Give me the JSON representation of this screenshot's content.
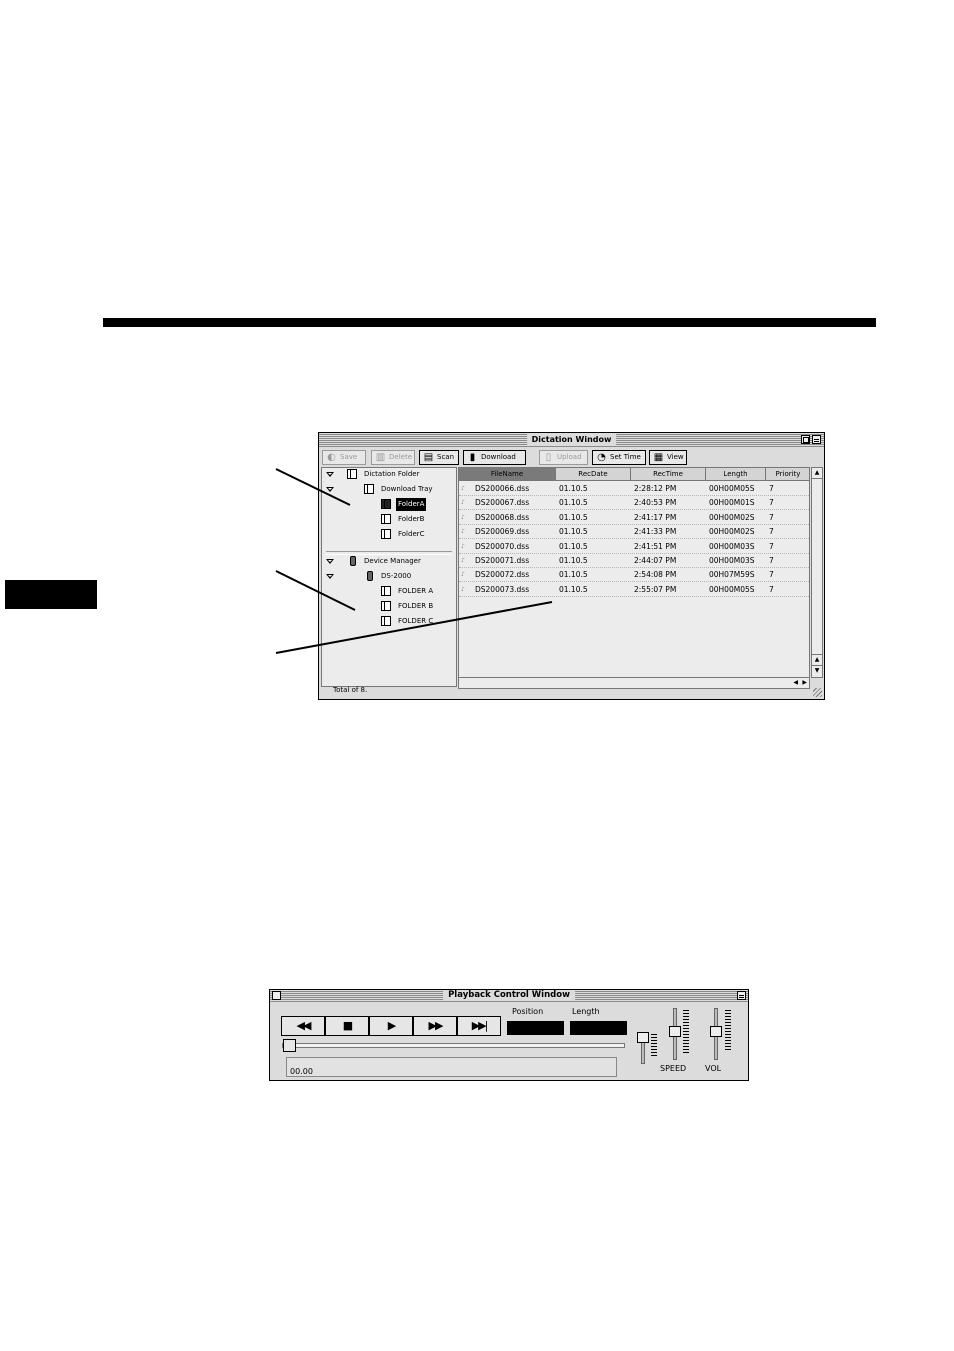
{
  "dictation_window": {
    "title": "Dictation Window",
    "toolbar": [
      {
        "label": "Save",
        "icon": "save-icon",
        "glyph": "◐",
        "enabled": false
      },
      {
        "label": "Delete",
        "icon": "trash-icon",
        "glyph": "▥",
        "enabled": false
      },
      {
        "label": "Scan",
        "icon": "scan-icon",
        "glyph": "▤",
        "enabled": true
      },
      {
        "label": "Download",
        "icon": "download-icon",
        "glyph": "▮",
        "enabled": true
      },
      {
        "label": "Upload",
        "icon": "upload-icon",
        "glyph": "▯",
        "enabled": false
      },
      {
        "label": "Set Time",
        "icon": "clock-icon",
        "glyph": "◔",
        "enabled": true
      },
      {
        "label": "View",
        "icon": "view-icon",
        "glyph": "▦",
        "enabled": true
      }
    ],
    "tree": {
      "dictation_folder": "Dictation Folder",
      "download_tray": "Download Tray",
      "folder_a": "FolderA",
      "folder_b": "FolderB",
      "folder_c": "FolderC",
      "device_manager": "Device Manager",
      "device": "DS-2000",
      "dev_folder_a": "FOLDER A",
      "dev_folder_b": "FOLDER B",
      "dev_folder_c": "FOLDER C"
    },
    "columns": [
      "FileName",
      "RecDate",
      "RecTime",
      "Length",
      "Priority"
    ],
    "rows": [
      {
        "file": "DS200066.dss",
        "date": "01.10.5",
        "time": "2:28:12 PM",
        "length": "00H00M05S",
        "priority": "7"
      },
      {
        "file": "DS200067.dss",
        "date": "01.10.5",
        "time": "2:40:53 PM",
        "length": "00H00M01S",
        "priority": "7"
      },
      {
        "file": "DS200068.dss",
        "date": "01.10.5",
        "time": "2:41:17 PM",
        "length": "00H00M02S",
        "priority": "7"
      },
      {
        "file": "DS200069.dss",
        "date": "01.10.5",
        "time": "2:41:33 PM",
        "length": "00H00M02S",
        "priority": "7"
      },
      {
        "file": "DS200070.dss",
        "date": "01.10.5",
        "time": "2:41:51 PM",
        "length": "00H00M03S",
        "priority": "7"
      },
      {
        "file": "DS200071.dss",
        "date": "01.10.5",
        "time": "2:44:07 PM",
        "length": "00H00M03S",
        "priority": "7"
      },
      {
        "file": "DS200072.dss",
        "date": "01.10.5",
        "time": "2:54:08 PM",
        "length": "00H07M59S",
        "priority": "7"
      },
      {
        "file": "DS200073.dss",
        "date": "01.10.5",
        "time": "2:55:07 PM",
        "length": "00H00M05S",
        "priority": "7"
      }
    ],
    "status": "Total of 8."
  },
  "playback_window": {
    "title": "Playback Control Window",
    "buttons": {
      "rewind": "◀◀",
      "stop": "■",
      "play": "▶",
      "fast_forward": "▶▶",
      "next": "▶▶|"
    },
    "position_label": "Position",
    "length_label": "Length",
    "time_display": "00.00",
    "speed_label": "SPEED",
    "volume_label": "VOL"
  }
}
